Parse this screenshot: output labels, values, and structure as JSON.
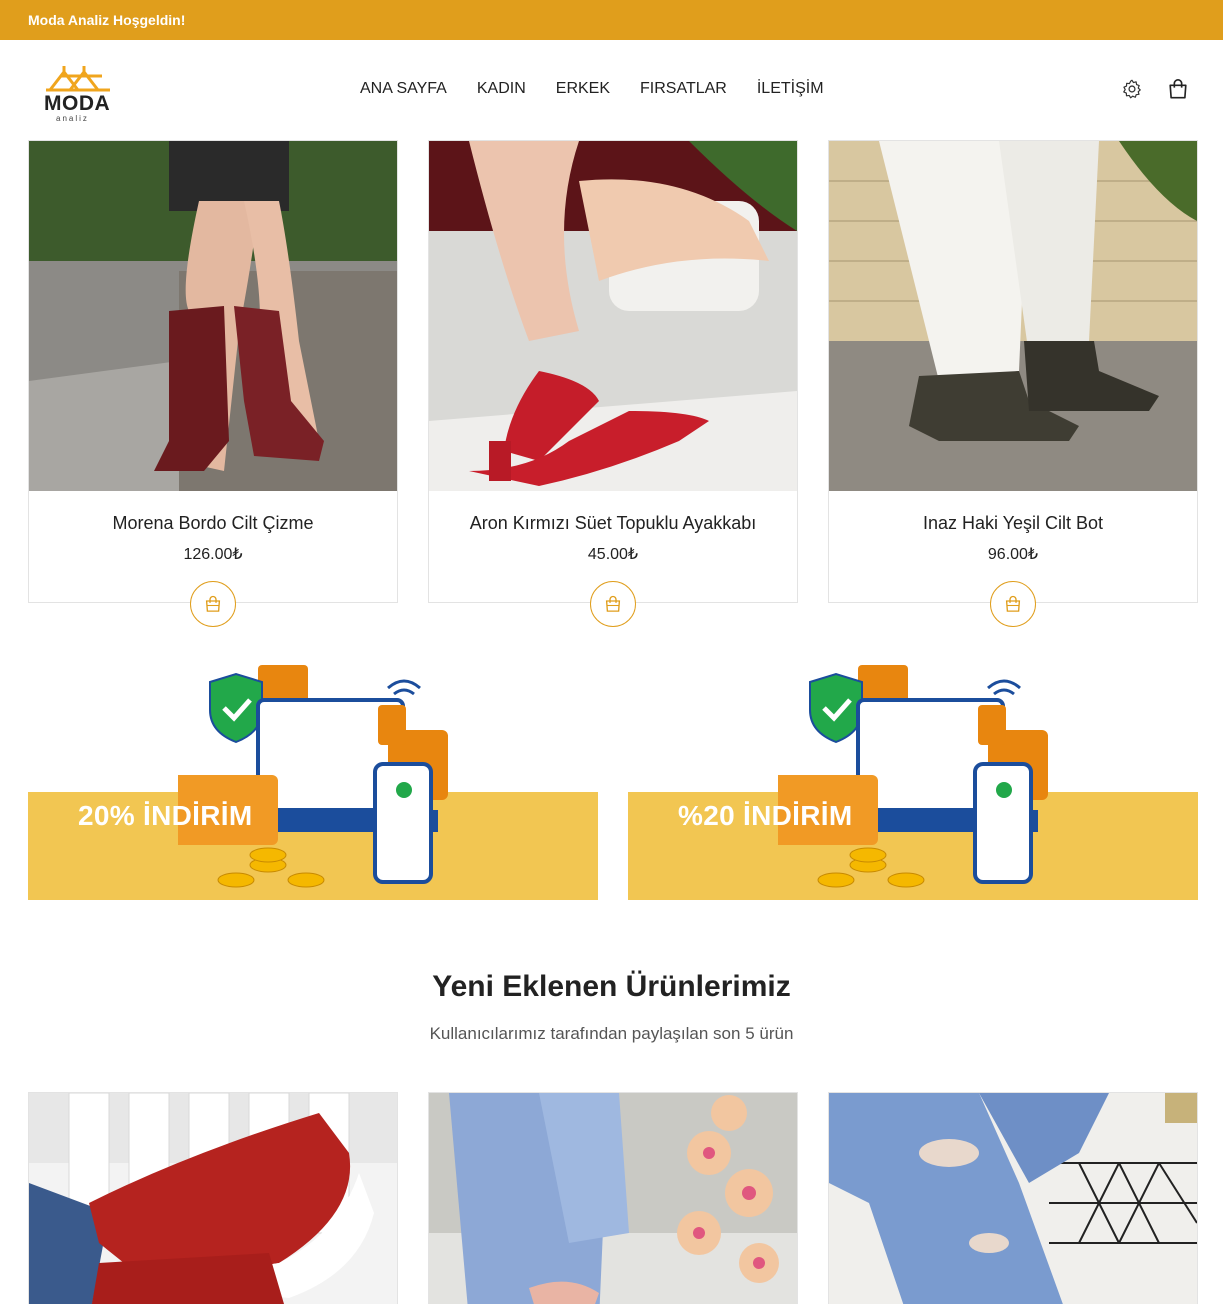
{
  "topbar": {
    "welcome": "Moda Analiz Hoşgeldin!"
  },
  "header": {
    "logo": {
      "word": "MODA",
      "sub": "analiz"
    },
    "nav": [
      {
        "label": "ANA SAYFA"
      },
      {
        "label": "KADIN"
      },
      {
        "label": "ERKEK"
      },
      {
        "label": "FIRSATLAR"
      },
      {
        "label": "İLETİŞİM"
      }
    ],
    "icons": [
      "gear-icon",
      "shopping-bag-icon"
    ]
  },
  "products": [
    {
      "name": "Morena Bordo Cilt Çizme",
      "price": "126.00₺"
    },
    {
      "name": "Aron Kırmızı Süet Topuklu Ayakkabı",
      "price": "45.00₺"
    },
    {
      "name": "Inaz Haki Yeşil Cilt Bot",
      "price": "96.00₺"
    }
  ],
  "banners": [
    {
      "title": "20% İNDİRİM"
    },
    {
      "title": "%20 İNDİRİM"
    }
  ],
  "new_section": {
    "title": "Yeni Eklenen Ürünlerimiz",
    "subtitle": "Kullanıcılarımız tarafından paylaşılan son 5 ürün"
  },
  "colors": {
    "accent": "#e09e1c",
    "banner_band": "#f2c652"
  }
}
